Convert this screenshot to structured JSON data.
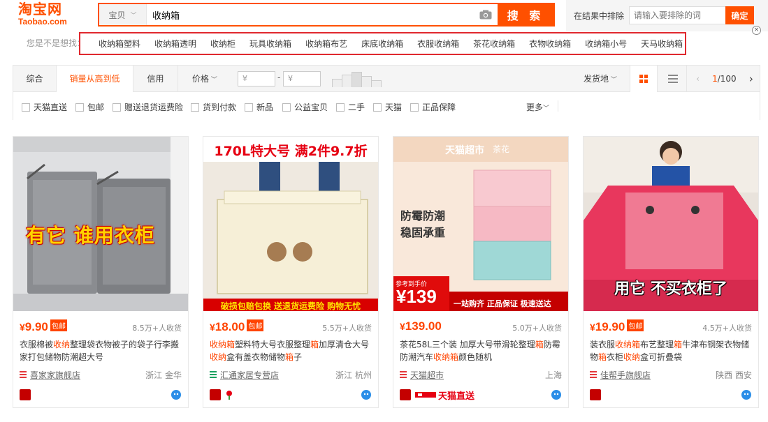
{
  "header": {
    "logo_main": "淘宝网",
    "logo_sub": "Taobao.com",
    "search_type": "宝贝",
    "search_value": "收纳箱",
    "search_button": "搜 索",
    "exclude_label": "在结果中排除",
    "exclude_placeholder": "请输入要排除的词",
    "exclude_button": "确定",
    "close_glyph": "×"
  },
  "suggest": {
    "label": "您是不是想找：",
    "items": [
      "收纳箱塑料",
      "收纳箱透明",
      "收纳柜",
      "玩具收纳箱",
      "收纳箱布艺",
      "床底收纳箱",
      "衣服收纳箱",
      "茶花收纳箱",
      "衣物收纳箱",
      "收纳箱小号",
      "天马收纳箱"
    ]
  },
  "sort": {
    "tabs": [
      "综合",
      "销量从高到低",
      "信用",
      "价格"
    ],
    "price_from_placeholder": "¥",
    "price_to_placeholder": "¥",
    "price_dash": "-",
    "ship_from": "发货地",
    "page_current": "1",
    "page_total": "/100"
  },
  "checks": {
    "items": [
      "天猫直送",
      "包邮",
      "赠送退货运费险",
      "货到付款",
      "新品",
      "公益宝贝",
      "二手",
      "天猫",
      "正品保障"
    ],
    "more": "更多"
  },
  "products": [
    {
      "price": "9.90",
      "yen": "¥",
      "post_tag": "包邮",
      "sold": "8.5万+人收货",
      "title_parts": [
        "衣服棉被",
        "收纳",
        "整理袋衣物被子的袋子行李搬家打包储物防潮超大号"
      ],
      "shop": "喜家家旗舰店",
      "location": "浙江 金华",
      "img_text": "有它 谁用衣柜"
    },
    {
      "price": "18.00",
      "yen": "¥",
      "post_tag": "包邮",
      "sold": "5.5万+人收货",
      "title_parts": [
        "收纳箱",
        "塑料特大号衣服整理",
        "箱",
        "加厚清仓大号",
        "收纳",
        "盒有盖衣物储物",
        "箱",
        "子"
      ],
      "shop": "汇通家居专营店",
      "location": "浙江 杭州",
      "img_top": "170L特大号  满2件9.7折",
      "img_bottom": "破损包赔包换  送退货运费险  购物无忧"
    },
    {
      "price": "139.00",
      "yen": "¥",
      "sold": "5.0万+人收货",
      "title_parts": [
        "茶花58L三个装 加厚大号带滑轮整理",
        "箱",
        "防霉防潮汽车",
        "收纳箱",
        "颜色随机"
      ],
      "shop": "天猫超市",
      "location": "上海",
      "img_header": "天猫超市",
      "img_brand": "茶花",
      "img_line1": "防霉防潮",
      "img_line2": "稳固承重",
      "img_ref": "参考到手价",
      "img_price": "¥139",
      "img_slogan": "一站购齐  正品保证  极速送达",
      "direct_label": "天猫直送"
    },
    {
      "price": "19.90",
      "yen": "¥",
      "post_tag": "包邮",
      "sold": "4.5万+人收货",
      "title_parts": [
        "装衣服",
        "收纳箱",
        "布艺整理",
        "箱",
        "牛津布钢架衣物储物",
        "箱",
        "衣柜",
        "收纳",
        "盒可折叠袋"
      ],
      "shop": "佳帮手旗舰店",
      "location": "陕西 西安",
      "img_text": "用它 不买衣柜了"
    }
  ],
  "colors": {
    "brand": "#ff5000",
    "price": "#ff4400",
    "highlight_border": "#e0282e"
  }
}
